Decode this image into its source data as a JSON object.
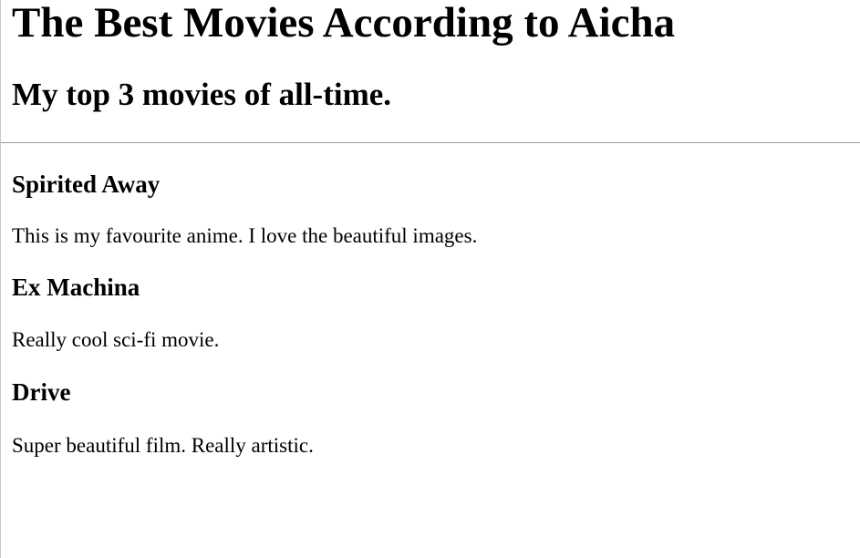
{
  "page": {
    "title": "The Best Movies According to Aicha",
    "subtitle": "My top 3 movies of all-time."
  },
  "movies": [
    {
      "title": "Spirited Away",
      "description": "This is my favourite anime. I love the beautiful images."
    },
    {
      "title": "Ex Machina",
      "description": "Really cool sci-fi movie."
    },
    {
      "title": "Drive",
      "description": "Super beautiful film. Really artistic."
    }
  ]
}
